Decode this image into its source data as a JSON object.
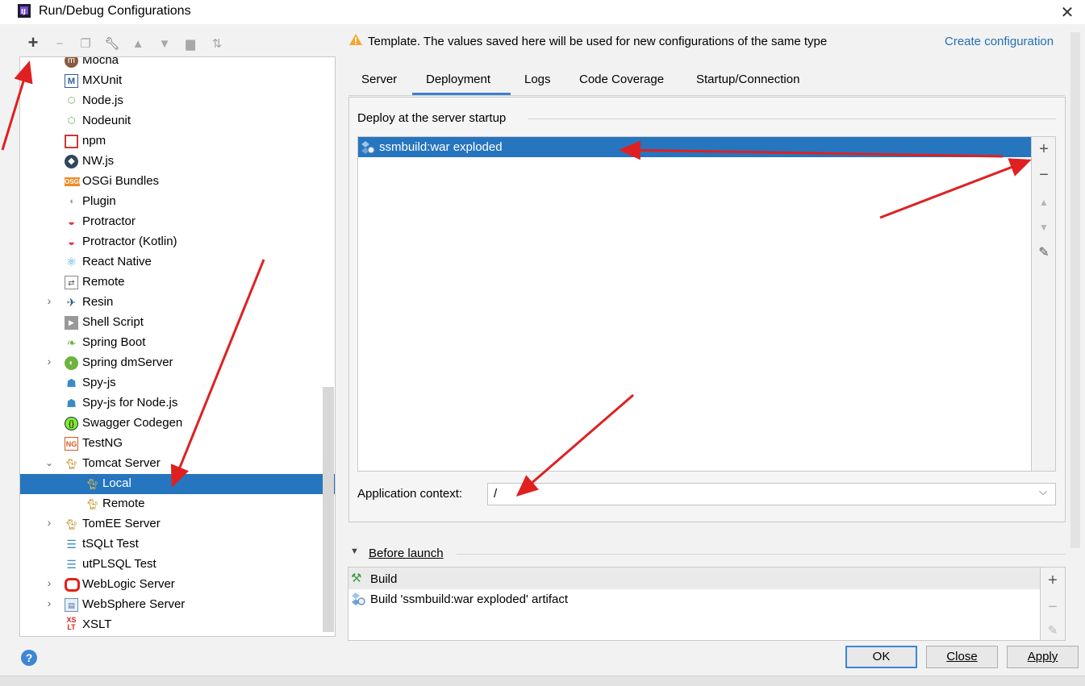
{
  "window": {
    "title": "Run/Debug Configurations"
  },
  "tree": {
    "items": [
      {
        "label": "Mocha",
        "icon": "mocha-icon"
      },
      {
        "label": "MXUnit",
        "icon": "mxunit-icon"
      },
      {
        "label": "Node.js",
        "icon": "nodejs-icon"
      },
      {
        "label": "Nodeunit",
        "icon": "nodeunit-icon"
      },
      {
        "label": "npm",
        "icon": "npm-icon"
      },
      {
        "label": "NW.js",
        "icon": "nwjs-icon"
      },
      {
        "label": "OSGi Bundles",
        "icon": "osgi-icon"
      },
      {
        "label": "Plugin",
        "icon": "plugin-icon"
      },
      {
        "label": "Protractor",
        "icon": "protractor-icon"
      },
      {
        "label": "Protractor (Kotlin)",
        "icon": "protractor-icon"
      },
      {
        "label": "React Native",
        "icon": "react-icon"
      },
      {
        "label": "Remote",
        "icon": "remote-icon"
      },
      {
        "label": "Resin",
        "icon": "resin-icon"
      },
      {
        "label": "Shell Script",
        "icon": "shell-icon"
      },
      {
        "label": "Spring Boot",
        "icon": "spring-boot-icon"
      },
      {
        "label": "Spring dmServer",
        "icon": "spring-icon"
      },
      {
        "label": "Spy-js",
        "icon": "spy-icon"
      },
      {
        "label": "Spy-js for Node.js",
        "icon": "spy-icon"
      },
      {
        "label": "Swagger Codegen",
        "icon": "swagger-icon"
      },
      {
        "label": "TestNG",
        "icon": "testng-icon"
      },
      {
        "label": "Tomcat Server",
        "icon": "tomcat-icon"
      },
      {
        "label": "Local",
        "icon": "tomcat-icon"
      },
      {
        "label": "Remote",
        "icon": "tomcat-icon"
      },
      {
        "label": "TomEE Server",
        "icon": "tomcat-icon"
      },
      {
        "label": "tSQLt Test",
        "icon": "database-icon"
      },
      {
        "label": "utPLSQL Test",
        "icon": "database-icon"
      },
      {
        "label": "WebLogic Server",
        "icon": "weblogic-icon"
      },
      {
        "label": "WebSphere Server",
        "icon": "websphere-icon"
      },
      {
        "label": "XSLT",
        "icon": "xslt-icon"
      }
    ],
    "osgi_badge": "OSGI",
    "testng_badge": "NG",
    "xslt_badge_top": "XS",
    "xslt_badge_bottom": "LT"
  },
  "template_message": "Template. The values saved here will be used for new configurations of the same type",
  "create_configuration": "Create configuration",
  "tabs": [
    "Server",
    "Deployment",
    "Logs",
    "Code Coverage",
    "Startup/Connection"
  ],
  "deployment": {
    "group_title": "Deploy at the server startup",
    "items": [
      "ssmbuild:war exploded"
    ],
    "app_context_label": "Application context:",
    "app_context_value": "/"
  },
  "before_launch": {
    "title": "Before launch",
    "items": [
      "Build",
      "Build 'ssmbuild:war exploded' artifact"
    ]
  },
  "buttons": {
    "ok": "OK",
    "close": "Close",
    "apply": "Apply",
    "help": "?"
  },
  "colors": {
    "selection": "#2675bf",
    "link": "#2470b3",
    "annotation_arrow": "#e02020"
  }
}
